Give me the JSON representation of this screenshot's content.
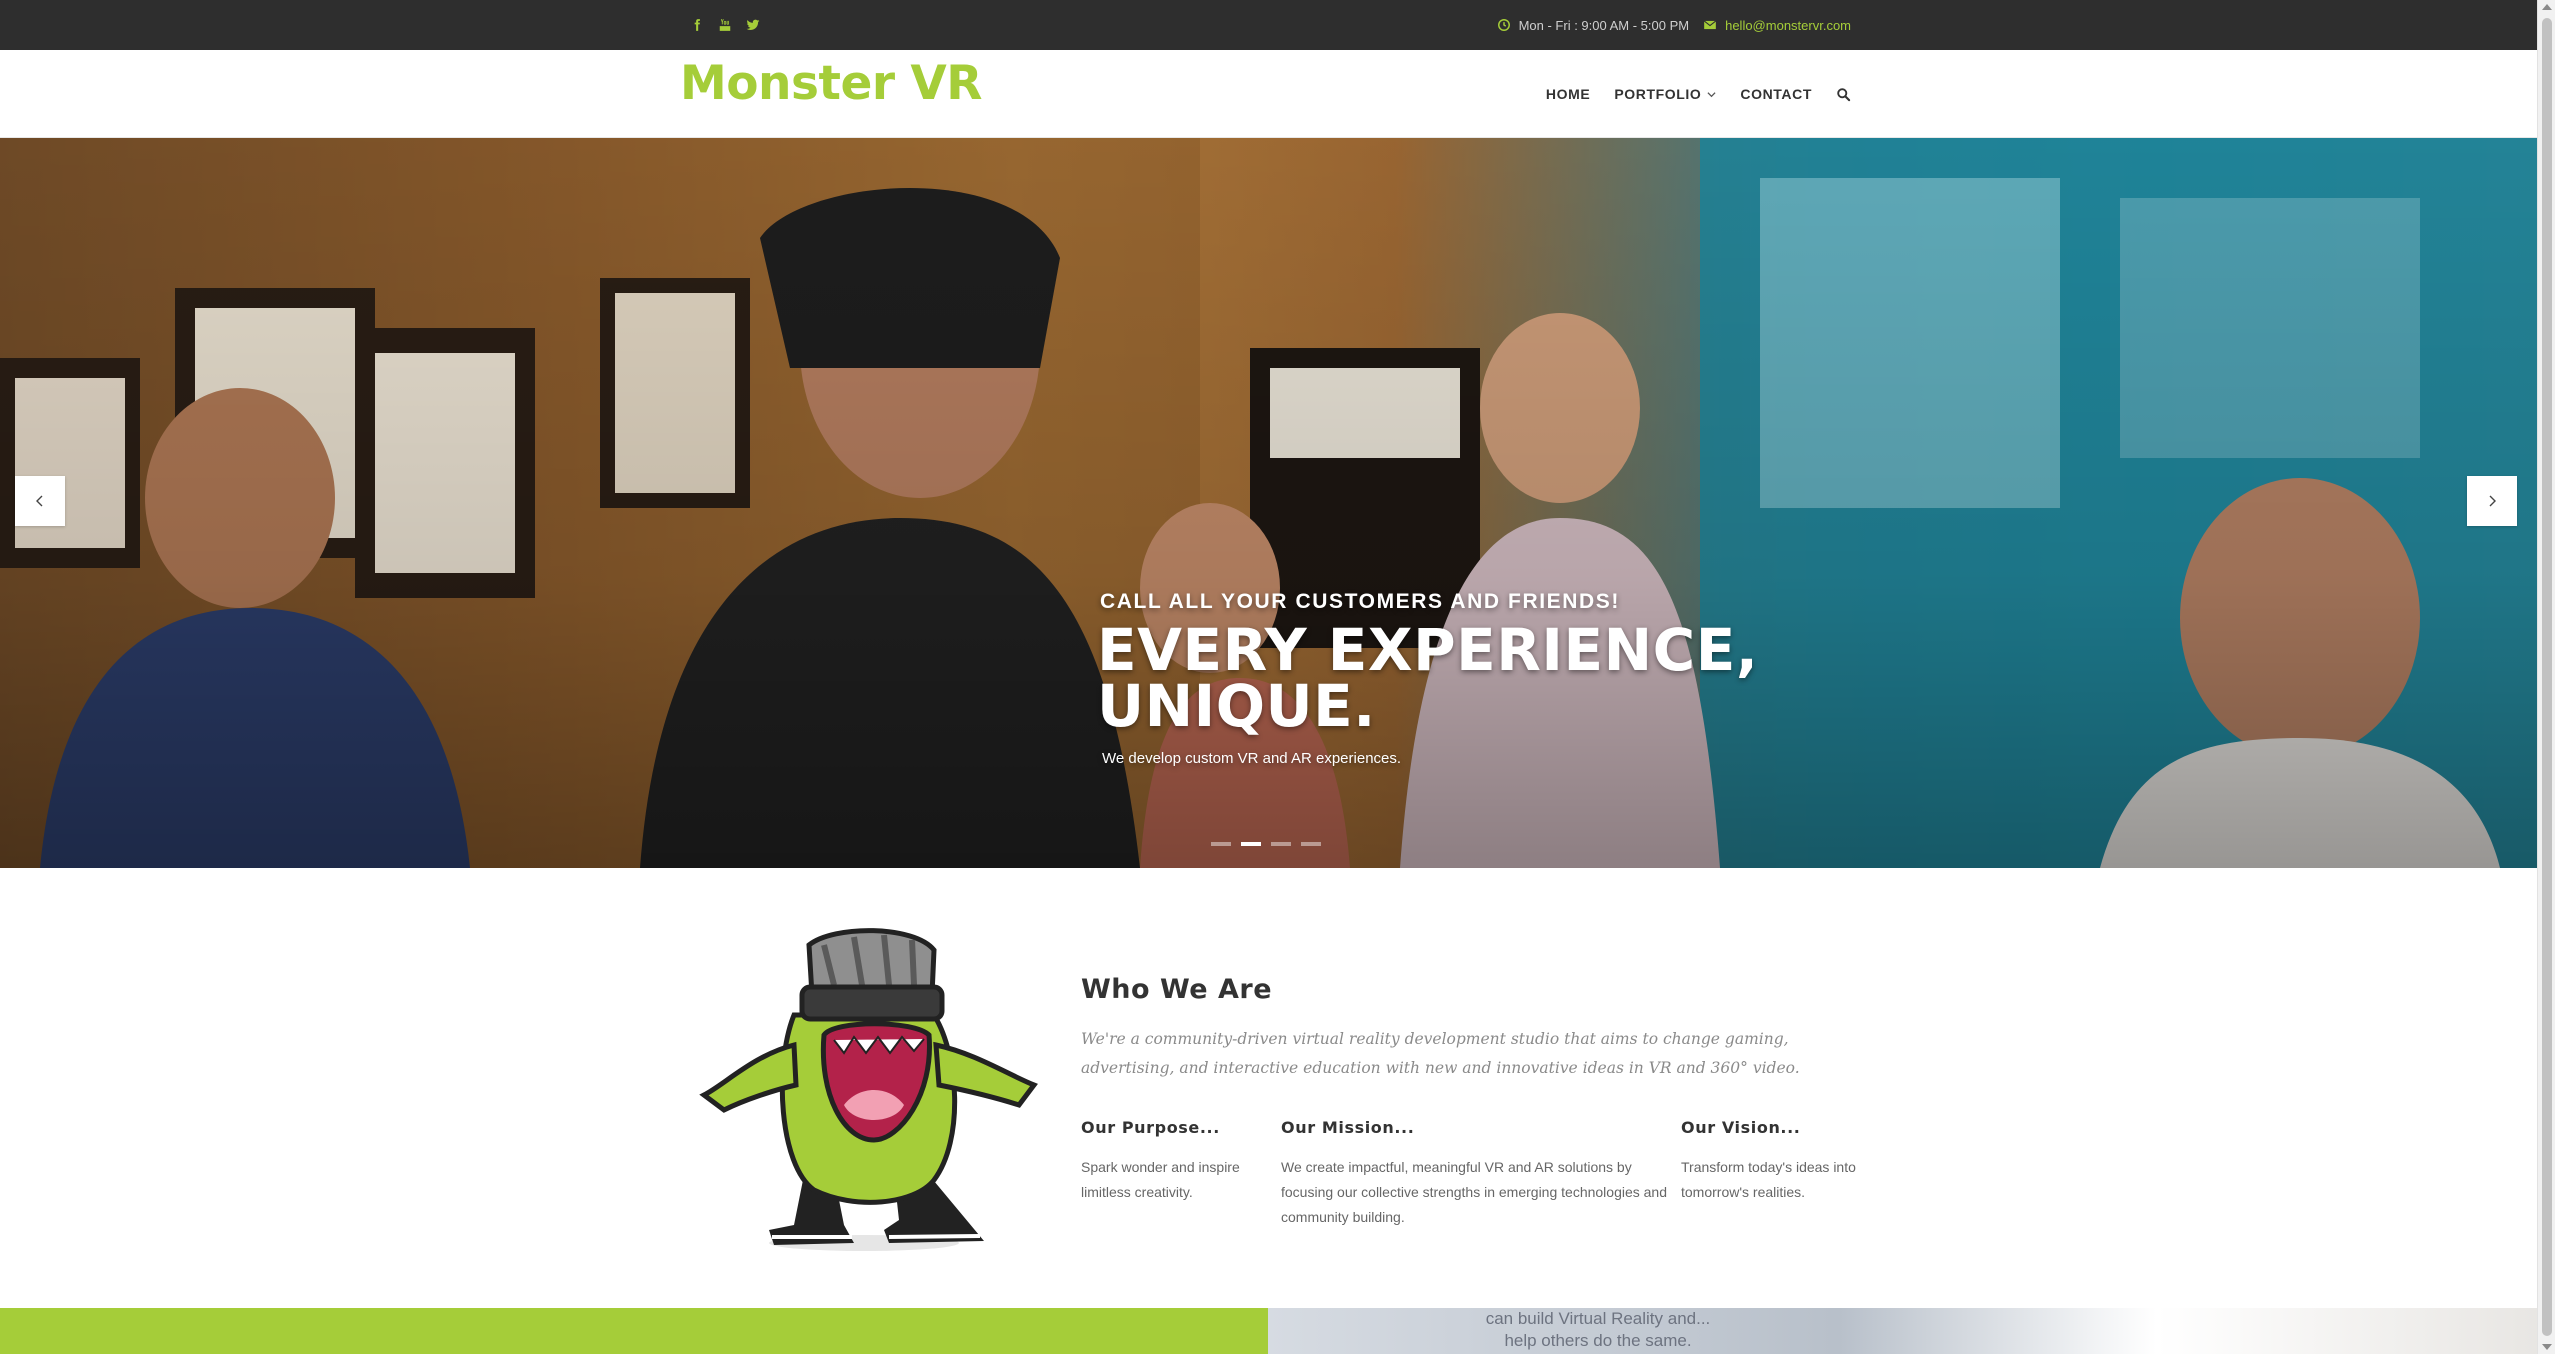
{
  "topbar": {
    "social": [
      {
        "icon": "facebook-icon"
      },
      {
        "icon": "youtube-icon"
      },
      {
        "icon": "twitter-icon"
      }
    ],
    "hours_icon": "clock-icon",
    "hours": "Mon - Fri : 9:00 AM - 5:00 PM",
    "email_icon": "envelope-icon",
    "email": "hello@monstervr.com"
  },
  "header": {
    "logo": "Monster VR",
    "nav": [
      {
        "label": "HOME"
      },
      {
        "label": "PORTFOLIO",
        "has_dropdown": true
      },
      {
        "label": "CONTACT"
      }
    ],
    "search_icon": "search-icon"
  },
  "hero": {
    "subtitle": "CALL ALL YOUR CUSTOMERS AND FRIENDS!",
    "title_line1": "EVERY EXPERIENCE,",
    "title_line2": "UNIQUE.",
    "text": "We develop custom VR and AR experiences.",
    "slide_count": 4,
    "active_slide": 2
  },
  "about": {
    "title": "Who We Are",
    "lead": "We're a community-driven virtual reality development studio that aims to change gaming, advertising, and interactive education with new and innovative ideas in VR and 360° video.",
    "columns": [
      {
        "heading": "Our Purpose...",
        "text": "Spark wonder and inspire limitless creativity."
      },
      {
        "heading": "Our Mission...",
        "text": "We create impactful, meaningful VR and AR solutions by focusing our collective strengths in emerging technologies and community building."
      },
      {
        "heading": "Our Vision...",
        "text": "Transform today's ideas into tomorrow's realities."
      }
    ]
  },
  "band": {
    "photo_text_line1": "can build Virtual Reality and...",
    "photo_text_line2": "help others do the same."
  },
  "colors": {
    "brand_green": "#a5cd39",
    "topbar_bg": "#2e2e2e",
    "text_dark": "#333333"
  }
}
